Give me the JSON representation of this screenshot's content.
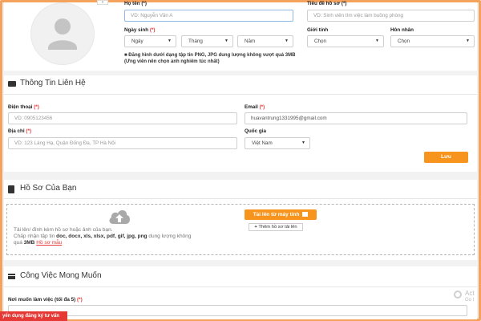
{
  "profile": {
    "fullname_label": "Họ tên (*)",
    "fullname_placeholder": "VD: Nguyễn Văn A",
    "title_label": "Tiêu đề hồ sơ (*)",
    "title_placeholder": "VD: Sinh viên tìm việc làm buồng phòng",
    "birthday_label": "Ngày sinh",
    "required_mark": "(*)",
    "day_value": "Ngày",
    "month_value": "Tháng",
    "year_value": "Năm",
    "gender_label": "Giới tính",
    "gender_value": "Chọn",
    "marital_label": "Hôn nhân",
    "marital_value": "Chọn",
    "photo_note": "Đăng hình dưới dạng tập tin PNG, JPG dung lượng không vượt quá 3MB (Ưng viên nên chọn ảnh nghiêm túc nhất)"
  },
  "contact": {
    "section_title": "Thông Tin Liên Hệ",
    "phone_label": "Điện thoại",
    "phone_placeholder": "VD: 0905123456",
    "email_label": "Email",
    "email_value": "huavantrung1331995@gmail.com",
    "address_label": "Địa chỉ",
    "address_placeholder": "VD:  123 Láng Hạ, Quận Đống Đa, TP Hà Nội",
    "country_label": "Quốc gia",
    "country_value": "Việt Nam",
    "save_label": "Lưu"
  },
  "resume": {
    "section_title": "Hồ Sơ Của Bạn",
    "upload_text_1": "Tải lên/ đính kèm hồ sơ hoặc ảnh của bạn.",
    "upload_text_2a": "Chấp nhận tập tin ",
    "upload_formats": "doc, docx, xls, xlsx, pdf, gif, jpg, png",
    "upload_text_2b": " dung lượng không",
    "upload_text_3a": "quá ",
    "upload_size": "3MB",
    "sample_link": "Hồ sơ mẫu",
    "upload_button": "Tải lên từ máy tính",
    "add_button": "Thêm hồ sơ tải lên"
  },
  "job": {
    "section_title": "Công Việc Mong Muốn",
    "location_label": "Nơi muốn làm việc (tối đa 5)",
    "bottom_tag": "yển dụng đăng ký tư vấn",
    "watermark": "Act",
    "watermark2": "Go t"
  },
  "colors": {
    "accent": "#f7941d",
    "frame": "#f5a25d",
    "required": "#e53935",
    "bottom_tag": "#e53935"
  }
}
